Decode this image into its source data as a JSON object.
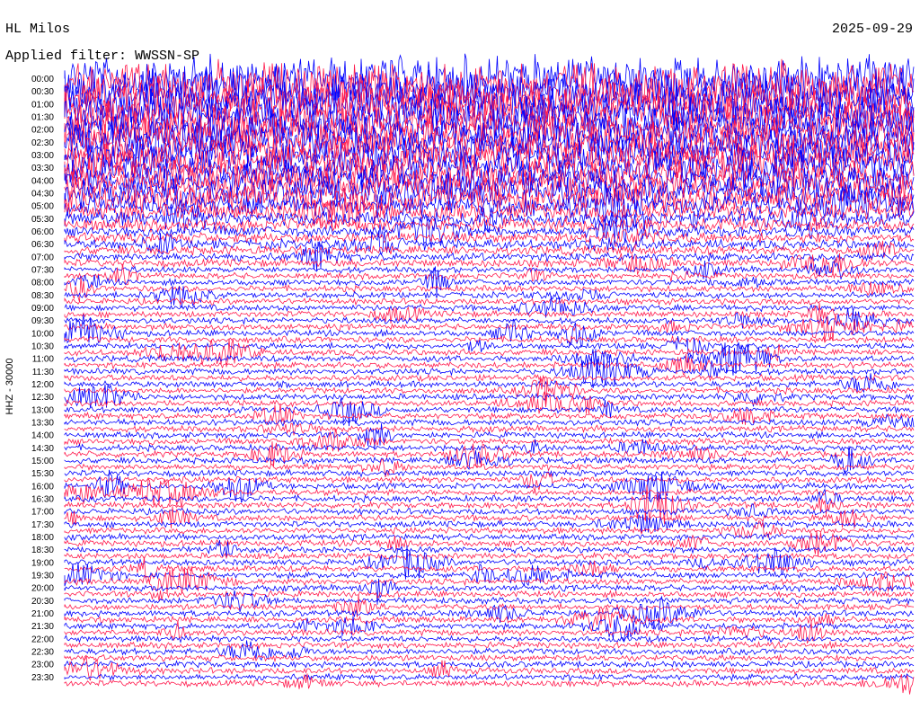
{
  "header": {
    "station": "HL Milos",
    "date": "2025-09-29",
    "filter_label": "Applied filter: WWSSN-SP"
  },
  "chart_data": {
    "type": "line",
    "title": "HL Milos",
    "date": "2025-09-29",
    "filter": "Applied filter: WWSSN-SP",
    "ylabel": "HHZ - 30000",
    "row_minutes": 15,
    "tick_labels": [
      "00:00",
      "00:30",
      "01:00",
      "01:30",
      "02:00",
      "02:30",
      "03:00",
      "03:30",
      "04:00",
      "04:30",
      "05:00",
      "05:30",
      "06:00",
      "06:30",
      "07:00",
      "07:30",
      "08:00",
      "08:30",
      "09:00",
      "09:30",
      "10:00",
      "10:30",
      "11:00",
      "11:30",
      "12:00",
      "12:30",
      "13:00",
      "13:30",
      "14:00",
      "14:30",
      "15:00",
      "15:30",
      "16:00",
      "16:30",
      "17:00",
      "17:30",
      "18:00",
      "18:30",
      "19:00",
      "19:30",
      "20:00",
      "20:30",
      "21:00",
      "21:30",
      "22:00",
      "22:30",
      "23:00",
      "23:30"
    ],
    "colors": [
      "#0000ff",
      "#ff1a4d"
    ],
    "grid": false,
    "legend": "none"
  }
}
